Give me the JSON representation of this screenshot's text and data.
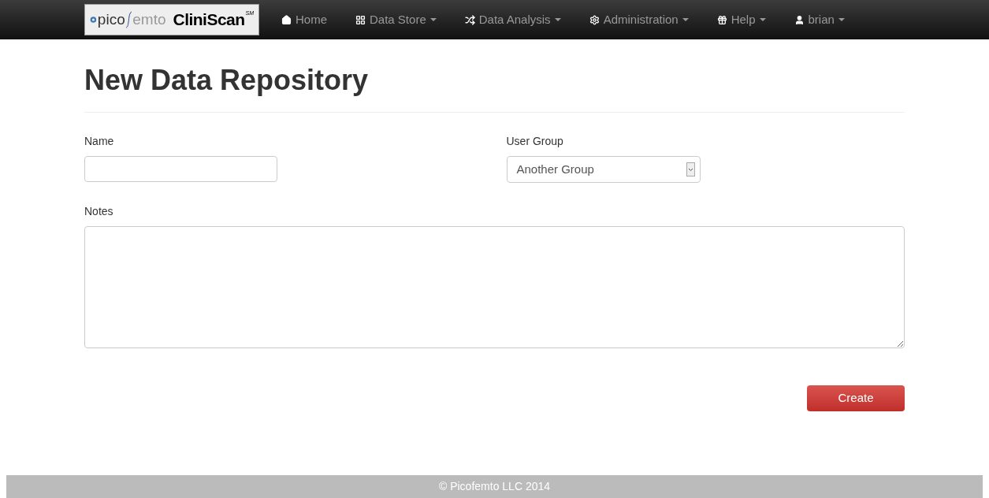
{
  "navbar": {
    "logo": {
      "left": "pico",
      "right": "emto",
      "product": "CliniScan",
      "mark": "SM"
    },
    "items": [
      {
        "label": "Home",
        "dropdown": false
      },
      {
        "label": "Data Store",
        "dropdown": true
      },
      {
        "label": "Data Analysis",
        "dropdown": true
      },
      {
        "label": "Administration",
        "dropdown": true
      },
      {
        "label": "Help",
        "dropdown": true
      },
      {
        "label": "brian",
        "dropdown": true
      }
    ]
  },
  "page": {
    "title": "New Data Repository",
    "fields": {
      "name": {
        "label": "Name"
      },
      "user_group": {
        "label": "User Group",
        "value": "Another Group"
      },
      "notes": {
        "label": "Notes"
      }
    },
    "submit": "Create"
  },
  "footer": "© Picofemto LLC 2014"
}
